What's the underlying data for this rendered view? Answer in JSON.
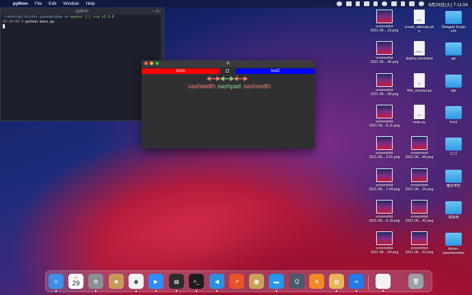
{
  "menubar": {
    "app": "python",
    "items": [
      "File",
      "Edit",
      "Window",
      "Help"
    ],
    "clock": "6月29日(火)  7:11:04"
  },
  "terminal": {
    "title": "python",
    "shortcut": "⌥⌘2",
    "prompt_path": "~/desktop/tkinter-panedwindow on",
    "prompt_branch": "master [!] via",
    "prompt_ver": "v3.9.6",
    "cmd_time": "07:10:49",
    "cmd": "> python main.py"
  },
  "tk": {
    "title": "tk",
    "pane1": "test1",
    "pane2": "test2",
    "labels": {
      "left": "sashwidth",
      "mid": "sashpad",
      "right": "sashwidth"
    },
    "colors": {
      "left": "#ff0000",
      "right": "#0000ff",
      "arrow_red": "#e8836f",
      "arrow_green": "#8fd18a"
    }
  },
  "desktop": [
    {
      "label": [
        "screenshot",
        "2021-06....23.png"
      ],
      "type": "thumb"
    },
    {
      "label": [
        "create_sitemap.ph",
        "p"
      ],
      "type": "file",
      "tag": "PHP"
    },
    {
      "label": [
        "Shingeki Kyojin",
        "v34"
      ],
      "type": "folder"
    },
    {
      "label": [
        "screenshot",
        "2021-06....40.png"
      ],
      "type": "thumb"
    },
    {
      "label": [
        "deploy.command"
      ],
      "type": "file",
      "tag": "SHELL"
    },
    {
      "label": [
        "api"
      ],
      "type": "folder"
    },
    {
      "label": [
        "screenshot",
        "2021-06....08.png"
      ],
      "type": "thumb"
    },
    {
      "label": [
        "404_checker.py"
      ],
      "type": "file",
      "tag": "PY"
    },
    {
      "label": [
        "site"
      ],
      "type": "folder"
    },
    {
      "label": [
        "screenshot",
        "2021-06....8.11.png"
      ],
      "type": "thumb"
    },
    {
      "label": [
        "main.py"
      ],
      "type": "file",
      "tag": "PY"
    },
    {
      "label": [
        "front"
      ],
      "type": "folder"
    },
    {
      "label": [
        "screenshot",
        "2021-06....3.01.png"
      ],
      "type": "thumb"
    },
    {
      "label": [
        "screenshot",
        "2021-06....40.png"
      ],
      "type": "thumb"
    },
    {
      "label": [
        "ロゴ"
      ],
      "type": "folder"
    },
    {
      "label": [
        "screenshot",
        "2021-06....7.04.png"
      ],
      "type": "thumb"
    },
    {
      "label": [
        "screenshot",
        "2021-06....29.png"
      ],
      "type": "thumb"
    },
    {
      "label": [
        "確定申告"
      ],
      "type": "folder"
    },
    {
      "label": [
        "screenshot",
        "2021-06....6.18.png"
      ],
      "type": "thumb"
    },
    {
      "label": [
        "screenshot",
        "2021-06....42.png"
      ],
      "type": "thumb"
    },
    {
      "label": [
        "保存用"
      ],
      "type": "folder"
    },
    {
      "label": [
        "screenshot",
        "2021-06....34.png"
      ],
      "type": "thumb"
    },
    {
      "label": [
        "screenshot",
        "2021-06....52.png"
      ],
      "type": "thumb"
    },
    {
      "label": [
        "tkinter-",
        "panedwindow"
      ],
      "type": "folder"
    }
  ],
  "dock": {
    "calendar_month": "6月",
    "calendar_day": "29",
    "apps": [
      {
        "name": "finder",
        "color": "#3d8fe6",
        "glyph": "☺"
      },
      {
        "name": "calendar",
        "color": "#ffffff",
        "glyph": ""
      },
      {
        "name": "system-preferences",
        "color": "#8a8f96",
        "glyph": "⚙"
      },
      {
        "name": "contacts",
        "color": "#c89a5a",
        "glyph": "☻"
      },
      {
        "name": "chrome",
        "color": "#f2f2f2",
        "glyph": "◉"
      },
      {
        "name": "zoom",
        "color": "#2d8cff",
        "glyph": "▶"
      },
      {
        "name": "activity-monitor",
        "color": "#2c2c2c",
        "glyph": "▤"
      },
      {
        "name": "terminal",
        "color": "#1c1c1c",
        "glyph": ">_"
      },
      {
        "name": "vscode",
        "color": "#2b8fe0",
        "glyph": "◀"
      },
      {
        "name": "instruments",
        "color": "#e9532a",
        "glyph": "↗"
      },
      {
        "name": "archive-utility",
        "color": "#c9a15a",
        "glyph": "▦"
      },
      {
        "name": "docker",
        "color": "#2496ed",
        "glyph": "▬"
      },
      {
        "name": "quicktime",
        "color": "#4a5a6a",
        "glyph": "Q"
      },
      {
        "name": "sourcetree",
        "color": "#f08a24",
        "glyph": "⋔"
      },
      {
        "name": "preview",
        "color": "#e8b35a",
        "glyph": "▨"
      },
      {
        "name": "infinity",
        "color": "#1f7aea",
        "glyph": "∞"
      },
      {
        "name": "document",
        "color": "#f2f2f2",
        "glyph": ""
      },
      {
        "name": "trash",
        "color": "#9aa0a8",
        "glyph": "🗑"
      }
    ]
  }
}
